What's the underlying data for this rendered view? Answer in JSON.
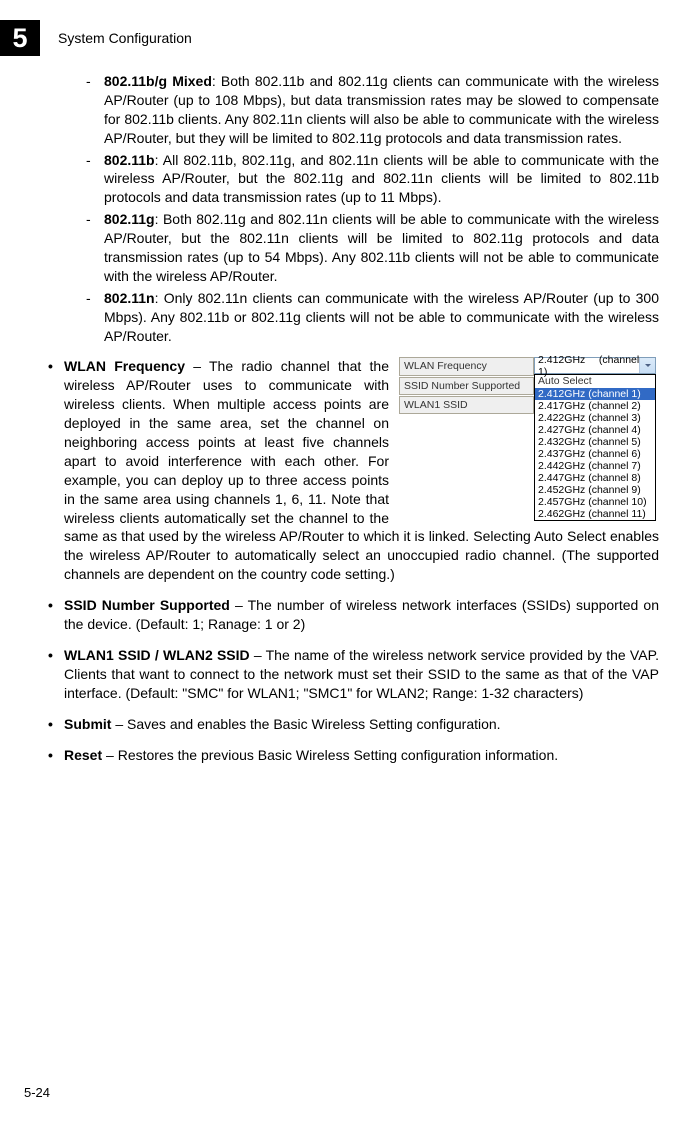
{
  "header": {
    "chapter_number": "5",
    "chapter_title": "System Configuration"
  },
  "sub_bullets": [
    {
      "term": "802.11b/g Mixed",
      "text": ": Both 802.11b and 802.11g clients can communicate with the wireless AP/Router (up to 108 Mbps), but data transmission rates may be slowed to compensate for 802.11b clients. Any 802.11n clients will also be able to communicate with the wireless AP/Router, but they will be limited to 802.11g protocols and data transmission rates."
    },
    {
      "term": "802.11b",
      "text": ": All 802.11b, 802.11g, and 802.11n clients will be able to communicate with the wireless AP/Router, but the 802.11g and 802.11n clients will be limited to 802.11b protocols and data transmission rates (up to 11 Mbps)."
    },
    {
      "term": "802.11g",
      "text": ": Both 802.11g and 802.11n clients will be able to communicate with the wireless AP/Router, but the 802.11n clients will be limited to 802.11g protocols and data transmission rates (up to 54 Mbps). Any 802.11b clients will not be able to communicate with the wireless AP/Router."
    },
    {
      "term": "802.11n",
      "text": ": Only 802.11n clients can communicate with the wireless AP/Router (up to 300 Mbps). Any 802.11b or 802.11g clients will not be able to communicate with the wireless AP/Router."
    }
  ],
  "top_bullets": {
    "wlan_freq": {
      "term": "WLAN Frequency",
      "text": " – The radio channel that the wireless AP/Router uses to communicate with wireless clients. When multiple access points are deployed in the same area, set the channel on neighboring access points at least five channels apart to avoid interference with each other. For example, you can deploy up to three access points in the same area using channels 1, 6, 11. Note that wireless clients automatically set the channel to the same as that used by the wireless AP/Router to which it is linked. Selecting Auto Select enables the wireless AP/Router to automatically select an unoccupied radio channel. (The supported channels are dependent on the country code setting.)"
    },
    "ssid_num": {
      "term": "SSID Number Supported",
      "text": " – The number of wireless network interfaces (SSIDs) supported on the device. (Default: 1; Ranage: 1 or 2)"
    },
    "wlan_ssid": {
      "term": "WLAN1 SSID / WLAN2 SSID",
      "text": " – The name of the wireless network service provided by the VAP. Clients that want to connect to the network must set their SSID to the same as that of the VAP interface. (Default: \"SMC\" for WLAN1; \"SMC1\" for WLAN2; Range: 1-32 characters)"
    },
    "submit": {
      "term": "Submit",
      "text": " – Saves and enables the Basic Wireless Setting configuration."
    },
    "reset": {
      "term": "Reset",
      "text": " – Restores the previous Basic Wireless Setting configuration information."
    }
  },
  "float_panel": {
    "labels": {
      "freq": "WLAN Frequency",
      "ssid_num": "SSID Number Supported",
      "wlan1": "WLAN1 SSID"
    },
    "select_value": "2.412GHz (channel 1)",
    "options": {
      "auto": "Auto Select",
      "c1": "2.412GHz (channel 1)",
      "c2": "2.417GHz (channel 2)",
      "c3": "2.422GHz (channel 3)",
      "c4": "2.427GHz (channel 4)",
      "c5": "2.432GHz (channel 5)",
      "c6": "2.437GHz (channel 6)",
      "c7": "2.442GHz (channel 7)",
      "c8": "2.447GHz (channel 8)",
      "c9": "2.452GHz (channel 9)",
      "c10": "2.457GHz (channel 10)",
      "c11": "2.462GHz (channel 11)"
    }
  },
  "page_number": "5-24"
}
